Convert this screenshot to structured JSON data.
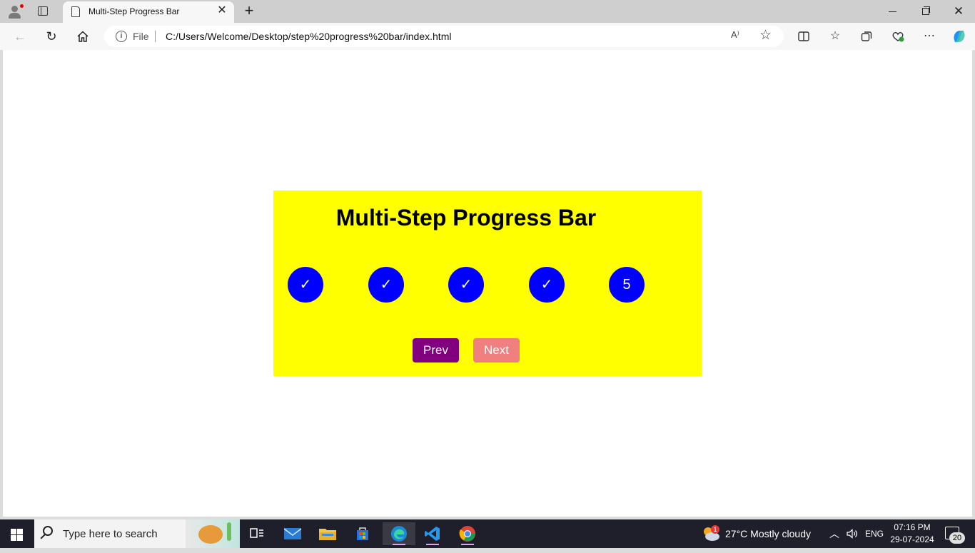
{
  "browser": {
    "tab_title": "Multi-Step Progress Bar",
    "tab_close": "✕",
    "new_tab": "+",
    "url_scheme": "File",
    "url": "C:/Users/Welcome/Desktop/step%20progress%20bar/index.html",
    "read_aloud": "A⁾",
    "favorite": "☆",
    "window_close": "✕"
  },
  "page": {
    "heading": "Multi-Step Progress Bar",
    "steps": [
      {
        "label": "✓",
        "state": "completed"
      },
      {
        "label": "✓",
        "state": "completed"
      },
      {
        "label": "✓",
        "state": "completed"
      },
      {
        "label": "✓",
        "state": "completed"
      },
      {
        "label": "5",
        "state": "active"
      }
    ],
    "prev_label": "Prev",
    "next_label": "Next",
    "colors": {
      "card": "#ffff00",
      "step": "#0000ff",
      "prev": "#800080",
      "next": "#f08080"
    }
  },
  "taskbar": {
    "search_placeholder": "Type here to search",
    "weather": "27°C  Mostly cloudy",
    "weather_alert_count": "1",
    "language": "ENG",
    "time": "07:16 PM",
    "date": "29-07-2024",
    "notifications": "20"
  }
}
